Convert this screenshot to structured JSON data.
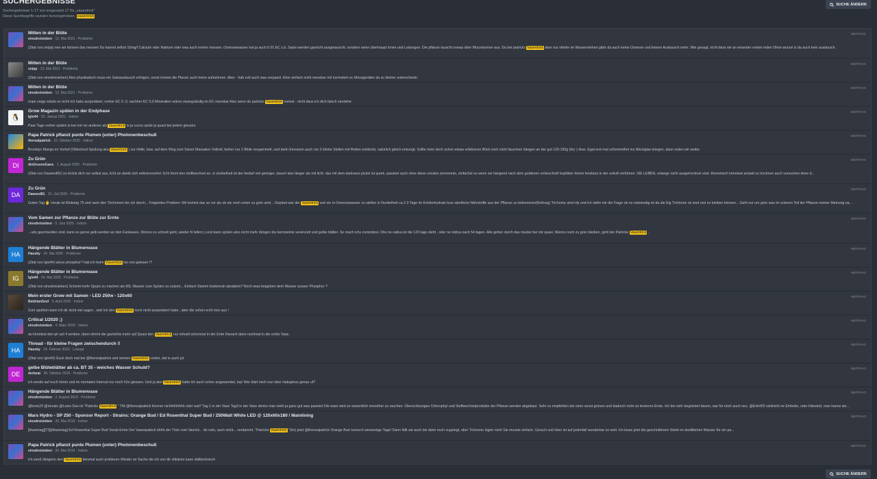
{
  "header": {
    "title": "SUCHERGEBNISSE",
    "summary": "Suchergebnisse 1-17 von insgesamt 17 für „vasentrick“",
    "highlight_note_prefix": "Diese Suchbegriffe wurden hervorgehoben:",
    "highlight_term": "vasentrick"
  },
  "buttons": {
    "change_search_label": "SUCHE ÄNDERN",
    "search_icon": "search-icon"
  },
  "colors": {
    "background": "#2a2f37",
    "highlight": "#f2c21a"
  },
  "results": [
    {
      "avatar": "img",
      "av": "",
      "title": "Mitten in der Blüte",
      "author": "einsdreisieben",
      "date": "12. Mai 2021",
      "forum": "Probleme",
      "tag": "BEITRAG",
      "pre": "(Zitat von snipp) nee wir können das messen Du kannst selbst 10mg/l Calcium oder Natrium oder was auch immer messen. Osmosewasser hat ja auch 0.01 EC z.b. Salze werden garnicht ausgetauscht, sondern wenn überhaupt Ionen und Ladungen. Die pflanze tauscht sowas über Wurzelzonen aus. Da bei patricks ",
      "hl": "Vasentrick",
      "post": " aber nur stiehle im Wasserstehen gibts da auch keine Osmose und keinen Austausch mehr. Wie gesagt, nicht dass wir an einander vorbei reden Ohne wurzel is da auch kein austausch."
    },
    {
      "avatar": "gray",
      "av": "",
      "title": "Mitten in der Blüte",
      "author": "snipp",
      "date": "12. Mai 2021",
      "forum": "Probleme",
      "tag": "BEITRAG",
      "pre": "(Zitat von einsdreisieben) Also physikalisch muss ein Salzaustausch erfolgen, sonst könnte die Planze auch keine aufnehmen. Aber - hab evtl auch was verpasst. Eher einfach nicht messbar mit normalem ec Messgeräten da zu kleiner unterschiedn.",
      "hl": "",
      "post": ""
    },
    {
      "avatar": "img",
      "av": "",
      "title": "Mitten in der Blüte",
      "author": "einsdreisieben",
      "date": "12. Mai 2021",
      "forum": "Probleme",
      "tag": "BEITRAG",
      "pre": "nope snipp würde es nicht ich habs ausprobiert, vorher EC 0 ,0, nachher EC 0,0 Mineralien wären zwangsläufig im EC messbar Also wenn du patricks ",
      "hl": "Vasentrick",
      "post": " meinst - nicht dass ich dich falsch verstehe"
    },
    {
      "avatar": "peng",
      "av": "🐧",
      "title": "Grow Magazin spülen in der Endphase",
      "author": "Iglo44",
      "date": "22. Januar 2021",
      "forum": "Indoor",
      "tag": "BEITRAG",
      "pre": "Paar Tage vorher spülen is bei mir nix anderes als ",
      "hl": "Vasentrick",
      "post": " is ja cocos spüle ja quasi bei jedem giessen"
    },
    {
      "avatar": "orange",
      "av": "",
      "title": "Papa Patrick pflanzt punte Plumen (unter) Photonenbeschuß",
      "author": "therealpatrick",
      "date": "10. Oktober 2020",
      "forum": "Indoor",
      "tag": "BEITRAG",
      "pre": "Brooklyn Mango im Vorhof (Oldschool-Spülung aka ",
      "hl": "Vasentrick",
      "post": " ) zur Hölle, bzw. auf dem Weg zum Sissor Massaker Vollreif, bisher nur 1 Blüte vergammelt, und beim Einvasen auch nur 2 kleine Stellen mit Rotten entdeckt, natürlich gleich entsorgt. Sollte mein doch schon etwas erfahrener Blick mich nicht täuschen hängen an der gut 120-150g (dry ) dran. Egal erst mal schimmelfrei ins Weckglas kriegen, dann reden wir weiter"
    },
    {
      "avatar": "DI",
      "av": "DI",
      "bg": "#c026d3",
      "title": "Zu Grün",
      "author": "dieGrueneGans",
      "date": "1. August 2020",
      "forum": "Probleme",
      "tag": "BEITRAG",
      "pre": "(Zitat von Daweed81) so trickst dich nur selbst aus, licht an damit sich selbstverzehrt. licht tönnt den stoffwechsel an. in dunkelheit ist der bedarf viel geringer, dauert also länger als mit licht. das mit dem darkness pickel ist quark. passiert auch ohne diese voodoo zeremonie, einfachst so wenn sie hängend nach dem goldenen ernteschnitt kopfüber hinein feixttanz in der umluft vorführen. SIE LEBEN, solange nicht ausgetrocknet sind. theoretisch könntest anstatt zu trocknen auch versuchen done d...",
      "hl": "",
      "post": ""
    },
    {
      "avatar": "DA",
      "av": "DA",
      "bg": "#6d28d9",
      "title": "Zu Grün",
      "author": "Daweed81",
      "date": "31. Juli 2020",
      "forum": "Probleme",
      "tag": "BEITRAG",
      "pre": "Guten Tag 🖐 Heute ist Blütetag 79 und nach den Trichomen bin ich durch... Folgendes Problem: Mir kommt das so vor als ob sie noch unten zu grün sind... Geplant war der ",
      "hl": "Vasentrick",
      "post": " und sie in Osmosewasser zu stellen in Dunkelheit ca 2-3 Tage im Kohlenhydrate bzw sämtliche Nährstoffe aus der Pflanze zu bekommen(Reifung) Trichome sind rdy und ich stelle mir die Frage ob es notwendig ist da die Eig Trichome ok sind und so bleiben können... Geht nur um grün was im unteren Teil der Pflanze meiner Meinung na..."
    },
    {
      "avatar": "img",
      "av": "",
      "title": "Vom Samen zur Pflanze zur Blüte zur Ernte",
      "author": "einsdreisieben",
      "date": "5. Juni 2020",
      "forum": "Indoor",
      "tag": "BEITRAG",
      "pre": "...uds geschwollen sind, kann es gerne gelb werden an den Fanleaves. Wenns zu schnell geht, wieder N liefern.) und dann spülen also nicht mehr düngen bis bernsteinis vereinzelt und gelbe blätter. So mach ichs zumindest. Obs ne sativa ist die 120 tage steht , oder ne indica nach 54 tagen. Alle gehen durch das muster bei mir quasi. Wenns noch zu grün bleiben, geht der Patricks ",
      "hl": "Vasentrick",
      "post": " ."
    },
    {
      "avatar": "HA",
      "av": "HA",
      "bg": "#1d7fd6",
      "title": "Hängende Blätter in Blumenvase",
      "author": "Hausky",
      "date": "24. Mai 2020",
      "forum": "Probleme",
      "tag": "BEITRAG",
      "pre": "(Zitat von Iglo44) wieso phosphor? hab ich beim ",
      "hl": "Vasentrick",
      "post": " nix von gelesen !?"
    },
    {
      "avatar": "IG",
      "av": "IG",
      "bg": "#8a7a2e",
      "title": "Hängende Blätter in Blumenvase",
      "author": "Iglo44",
      "date": "24. Mai 2020",
      "forum": "Probleme",
      "tag": "BEITRAG",
      "pre": "(Zitat von einsdreisieben) Scheint mehr Spass zu machen als 60L Wasser zum Spülen zu nutzen... Einfach Stamm bodennah absäbeln? Noch iwas beigeben dem Wasser ausser Phosphor ?",
      "hl": "",
      "post": ""
    },
    {
      "avatar": "dark",
      "av": "",
      "title": "Mein erster Grow mit Samen - LED 250w - 120x60",
      "author": "BaldrianGod",
      "date": "3. April 2020",
      "forum": "Indoor",
      "tag": "BEITRAG",
      "pre": "Zum spühlen kann ich dir nicht viel sagen , weil ich den ",
      "hl": "Vasentrick",
      "post": " noch nicht ausprobiert habe , aber die sehen echt nice aus !"
    },
    {
      "avatar": "img",
      "av": "",
      "title": "Critical 1/2020 ;)",
      "author": "einsdreisieben",
      "date": "4. März 2020",
      "forum": "Indoor",
      "tag": "BEITRAG",
      "pre": "du könntest den ph auf 4 senken, dann nimmt die garnichts mehr auf Quasi den ",
      "hl": "Vasentrick",
      "post": " nur virtuell schonmal in der Erde Danach dann nochmal in die echte Vase."
    },
    {
      "avatar": "HA",
      "av": "HA",
      "bg": "#1d7fd6",
      "title": "Thread - für kleine Fragen zwischendurch !!",
      "author": "Hausky",
      "date": "24. Februar 2020",
      "forum": "Lounge",
      "tag": "BEITRAG",
      "pre": "(Zitat von Iglo44) Guck doch mal bei @therealpatrick und seinem ",
      "hl": "Vasentrick",
      "post": " vorbei, dat is auch jut"
    },
    {
      "avatar": "DE",
      "av": "DE",
      "bg": "#c026d3",
      "title": "gelbe Blüteblätter ab ca. BT 35 - weiches Wasser Schuld?",
      "author": "derbeat",
      "date": "28. Oktober 2019",
      "forum": "Probleme",
      "tag": "BEITRAG",
      "pre": "ich werde auf euch hören und im normalen Interval nur noch h2o giessen. Und ja den ",
      "hl": "Vasentrick",
      "post": " hatte ich auch schon angewendet, top! Wer klärt mich nun über Hakaphos genau uf?"
    },
    {
      "avatar": "img",
      "av": "",
      "title": "Hängende Blätter in Blumenvase",
      "author": "einsdreisieben",
      "date": "2. August 2019",
      "forum": "Probleme",
      "tag": "BEITRAG",
      "pre": "@kreis23 @mrsalz @Laiso Das ist \"Patricks ",
      "hl": "Vasentrick",
      "post": " \" TM @therealpatrick Kenner nichhhhhhhh oder wat? Tag 1 in der Vase Tag3 in der Vase denke man sieht ja ganz gut was passiert Die ware wird so wesentlich smoother zu rauchen. Überschüssiges Chlorophyl und Stoffwechselprodukte der Pflanze werden abgebaut. Sehr zu empfehlen bei einer sonst grünen und dadurch nicht so leckeren Ernte. Ich bin sehr begeistert davon, war für mich auch neu. @Erik420 vielleicht ne Embolie, oder Hitzetod, man kanns wir..."
    },
    {
      "avatar": "img",
      "av": "",
      "title": "Mars Hydro - SP 250 - Sponsor Report - Strains: Orange Bud / Ed Rosenthal Super Bud / 250Watt White LED @ 120x60x180 / Mainlining",
      "author": "einsdreisieben",
      "date": "20. Mai 2019",
      "forum": "Indoor",
      "tag": "BEITRAG",
      "pre": "[blueietag][73][/blueietag] Ed Rosenthal Super Bud Vorab-Ernte Der Vasenpatrick ähhh der Trick vom Vasrick... äh nein, auch nicht... verdammt. \"Patricks ",
      "hl": "Vasentrick",
      "post": " \"(tm) jetzt @therealpatrick Orange Bud nurnoch weeeenige Tage! Dann fällt sie auch bis dann noch zugelegt, aber Trichome lügen nicht Sie musste einfach. Geruch und Harz ist auf jedenfall wunderbar so weit. Ich lasse jetzt die geschnittenen Stiele im destillierten Wasser für ein pa..."
    },
    {
      "avatar": "img",
      "av": "",
      "title": "Papa Patrick pflanzt punte Plumen (unter) Photonenbeschuß",
      "author": "einsdreisieben",
      "date": "20. Mai 2019",
      "forum": "Indoor",
      "tag": "BEITRAG",
      "pre": "ich werd übrigens den ",
      "hl": "Vasentrick",
      "post": " diesmal auch probieren Wieder ne Sache die ich von dir stibitzen kann skilltechnisch"
    }
  ]
}
